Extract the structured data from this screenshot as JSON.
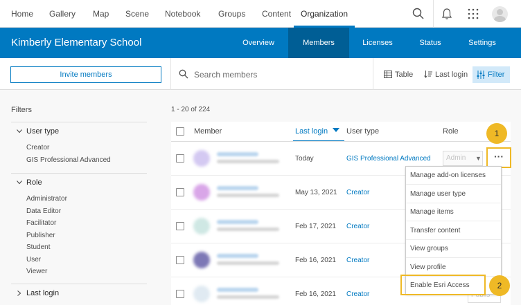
{
  "top_nav": {
    "items": [
      "Home",
      "Gallery",
      "Map",
      "Scene",
      "Notebook",
      "Groups",
      "Content",
      "Organization"
    ],
    "active": "Organization",
    "icons": [
      "search-icon",
      "bell-icon",
      "apps-grid-icon",
      "user-avatar"
    ]
  },
  "org_header": {
    "title": "Kimberly Elementary School",
    "tabs": [
      "Overview",
      "Members",
      "Licenses",
      "Status",
      "Settings"
    ],
    "active_tab": "Members",
    "color": "#0079c1",
    "active_color": "#005e95"
  },
  "toolbar": {
    "invite_label": "Invite members",
    "search_placeholder": "Search members",
    "table_label": "Table",
    "sort_label": "Last login",
    "filter_label": "Filter"
  },
  "filters": {
    "title": "Filters",
    "user_type": {
      "label": "User type",
      "items": [
        "Creator",
        "GIS Professional Advanced"
      ]
    },
    "role": {
      "label": "Role",
      "items": [
        "Administrator",
        "Data Editor",
        "Facilitator",
        "Publisher",
        "Student",
        "User",
        "Viewer"
      ]
    },
    "last_login": {
      "label": "Last login"
    }
  },
  "members": {
    "count_text": "1 - 20 of 224",
    "headers": {
      "member": "Member",
      "last_login": "Last login",
      "user_type": "User type",
      "role": "Role"
    },
    "rows": [
      {
        "last_login": "Today",
        "user_type": "GIS Professional Advanced",
        "role": "Admin"
      },
      {
        "last_login": "May 13, 2021",
        "user_type": "Creator"
      },
      {
        "last_login": "Feb 17, 2021",
        "user_type": "Creator"
      },
      {
        "last_login": "Feb 16, 2021",
        "user_type": "Creator"
      },
      {
        "last_login": "Feb 16, 2021",
        "user_type": "Creator",
        "role": "Publis"
      }
    ]
  },
  "more_button": {
    "label": "···"
  },
  "context_menu": {
    "items": [
      "Manage add-on licenses",
      "Manage user type",
      "Manage items",
      "Transfer content",
      "View groups",
      "View profile",
      "Enable Esri Access"
    ]
  },
  "callouts": [
    "1",
    "2"
  ],
  "callout_color": "#efb926"
}
